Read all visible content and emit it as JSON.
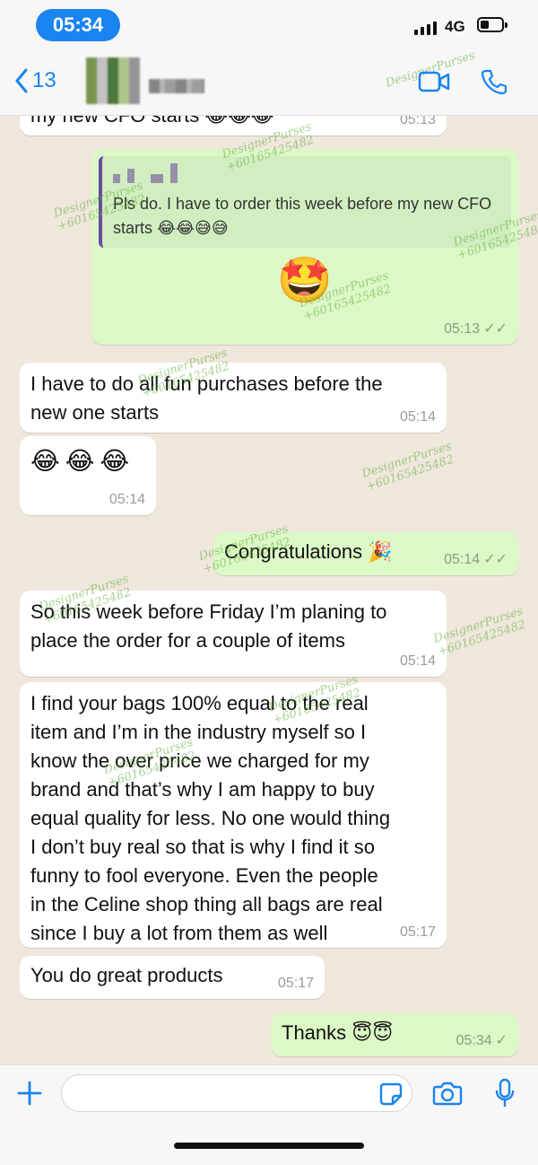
{
  "status_bar": {
    "time": "05:34",
    "network": "4G"
  },
  "header": {
    "back_count": "13"
  },
  "watermark": {
    "brand": "DesignerPurses",
    "phone": "+60165425482"
  },
  "messages": [
    {
      "dir": "in",
      "text": "my new CFO starts 😂😂😂",
      "time": "05:13"
    },
    {
      "dir": "out",
      "quoted_text": "Pls do. I have to order this week before my new CFO starts 😂😂😅😅",
      "emoji": "🤩",
      "time": "05:13",
      "status": "✓✓"
    },
    {
      "dir": "in",
      "text": "I have to do all fun purchases before the\nnew one starts",
      "time": "05:14"
    },
    {
      "dir": "in",
      "text": "😂😂😂",
      "time": "05:14"
    },
    {
      "dir": "out",
      "text": "Congratulations 🎉",
      "time": "05:14",
      "status": "✓✓"
    },
    {
      "dir": "in",
      "text": "So this week before Friday I’m planing to\nplace the order for a couple of items",
      "time": "05:14"
    },
    {
      "dir": "in",
      "text": "I find your bags 100% equal to the real\nitem and I’m in the industry myself so I\nknow the over price we charged for my\nbrand and that’s why I am happy to buy\nequal quality for less. No one would thing\nI don’t buy real so that is why I find it so\nfunny to fool everyone. Even the people\nin the Celine shop thing all bags are real\nsince I buy a lot from them as well",
      "time": "05:17"
    },
    {
      "dir": "in",
      "text": "You do great products",
      "time": "05:17"
    },
    {
      "dir": "out",
      "text": "Thanks 😇😇",
      "time": "05:34",
      "status": "✓"
    }
  ],
  "input": {
    "placeholder": ""
  },
  "colors": {
    "accent": "#1a84f0",
    "outgoing": "#dcf8c6",
    "incoming": "#ffffff"
  }
}
